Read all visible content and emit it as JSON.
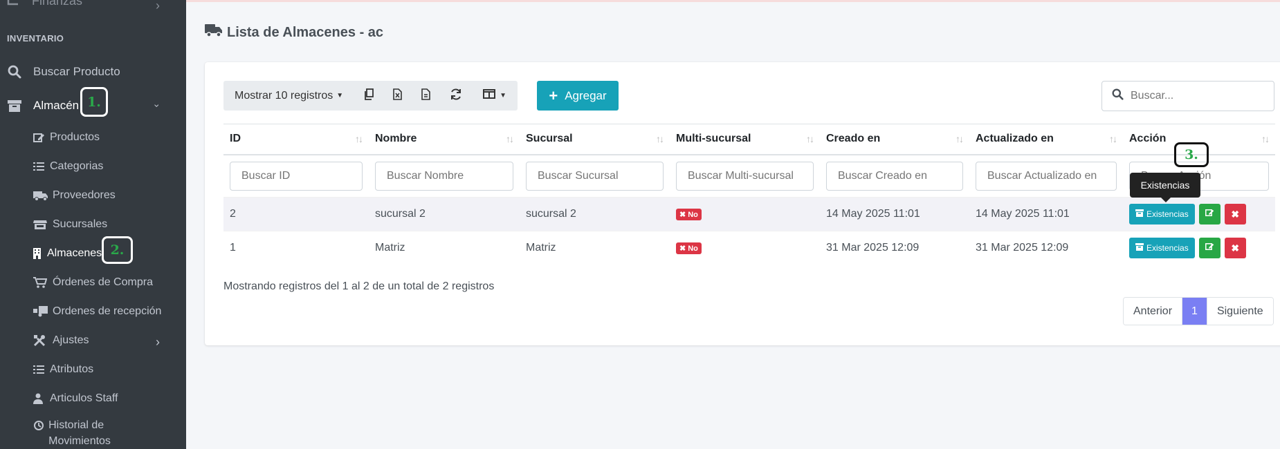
{
  "sidebar": {
    "top_cut_label": "Finanzas",
    "section_header": "INVENTARIO",
    "items": [
      {
        "label": "Buscar Producto",
        "icon": "search-icon"
      },
      {
        "label": "Almacén",
        "icon": "archive-icon"
      }
    ],
    "subitems": [
      {
        "label": "Productos",
        "icon": "edit-icon"
      },
      {
        "label": "Categorias",
        "icon": "list-icon"
      },
      {
        "label": "Proveedores",
        "icon": "truck-icon"
      },
      {
        "label": "Sucursales",
        "icon": "store-icon"
      },
      {
        "label": "Almacenes",
        "icon": "building-icon"
      },
      {
        "label": "Órdenes de Compra",
        "icon": "cart-icon"
      },
      {
        "label": "Ordenes de recepción",
        "icon": "truck-loading-icon"
      },
      {
        "label": "Ajustes",
        "icon": "tools-icon"
      },
      {
        "label": "Atributos",
        "icon": "list-icon"
      },
      {
        "label": "Articulos Staff",
        "icon": "user-tie-icon"
      },
      {
        "label": "Historial de Movimientos",
        "icon": "history-icon"
      }
    ]
  },
  "markers": {
    "m1": "1.",
    "m2": "2.",
    "m3": "3."
  },
  "page": {
    "title": "Lista de Almacenes - ac"
  },
  "toolbar": {
    "show_label": "Mostrar 10 registros",
    "add_label": "Agregar",
    "search_placeholder": "Buscar..."
  },
  "table": {
    "headers": [
      "ID",
      "Nombre",
      "Sucursal",
      "Multi-sucursal",
      "Creado en",
      "Actualizado en",
      "Acción"
    ],
    "filters": [
      "Buscar ID",
      "Buscar Nombre",
      "Buscar Sucursal",
      "Buscar Multi-sucursal",
      "Buscar Creado en",
      "Buscar Actualizado en",
      "Buscar Acción"
    ],
    "rows": [
      {
        "id": "2",
        "nombre": "sucursal 2",
        "sucursal": "sucursal 2",
        "multi": "No",
        "creado": "14 May 2025 11:01",
        "actualizado": "14 May 2025 11:01"
      },
      {
        "id": "1",
        "nombre": "Matriz",
        "sucursal": "Matriz",
        "multi": "No",
        "creado": "31 Mar 2025 12:09",
        "actualizado": "31 Mar 2025 12:09"
      }
    ],
    "action_label": "Existencias"
  },
  "tooltip": "Existencias",
  "footer": {
    "info": "Mostrando registros del 1 al 2 de un total de 2 registros",
    "prev": "Anterior",
    "page": "1",
    "next": "Siguiente"
  },
  "colors": {
    "sidebar": "#343a40",
    "accent": "#17a2b8",
    "success": "#28a745",
    "danger": "#dc3545",
    "page_active": "#7a7ff3"
  }
}
